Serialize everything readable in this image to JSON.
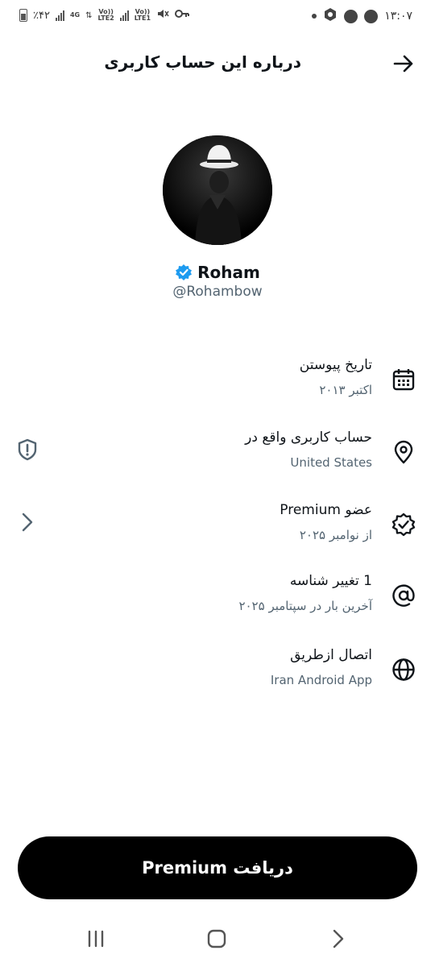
{
  "status_bar": {
    "time": "۱۳:۰۷",
    "battery": "٪۴۲",
    "net_4g": "4G",
    "lte2": "LTE2",
    "lte1": "LTE1",
    "volte": "Vo))"
  },
  "header": {
    "title": "درباره این حساب کاربری"
  },
  "profile": {
    "display_name": "Roham",
    "handle": "@Rohambow"
  },
  "info_rows": [
    {
      "title": "تاریخ پیوستن",
      "subtitle": "اکتبر ۲۰۱۳",
      "icon": "calendar-icon"
    },
    {
      "title": "حساب کاربری واقع در",
      "subtitle": "United States",
      "icon": "location-pin-icon"
    },
    {
      "title": "عضو Premium",
      "subtitle": "از نوامبر ۲۰۲۵",
      "icon": "verified-badge-icon"
    },
    {
      "title": "1 تغییر شناسه",
      "subtitle": "آخرین بار در سپتامبر ۲۰۲۵",
      "icon": "at-sign-icon"
    },
    {
      "title": "اتصال ازطریق",
      "subtitle": "Iran Android App",
      "icon": "globe-icon"
    }
  ],
  "premium_button": {
    "label": "دریافت Premium"
  },
  "colors": {
    "verified_blue": "#1d9bf0",
    "muted_text": "#536471",
    "primary_text": "#0f1419",
    "button_bg": "#000000"
  }
}
